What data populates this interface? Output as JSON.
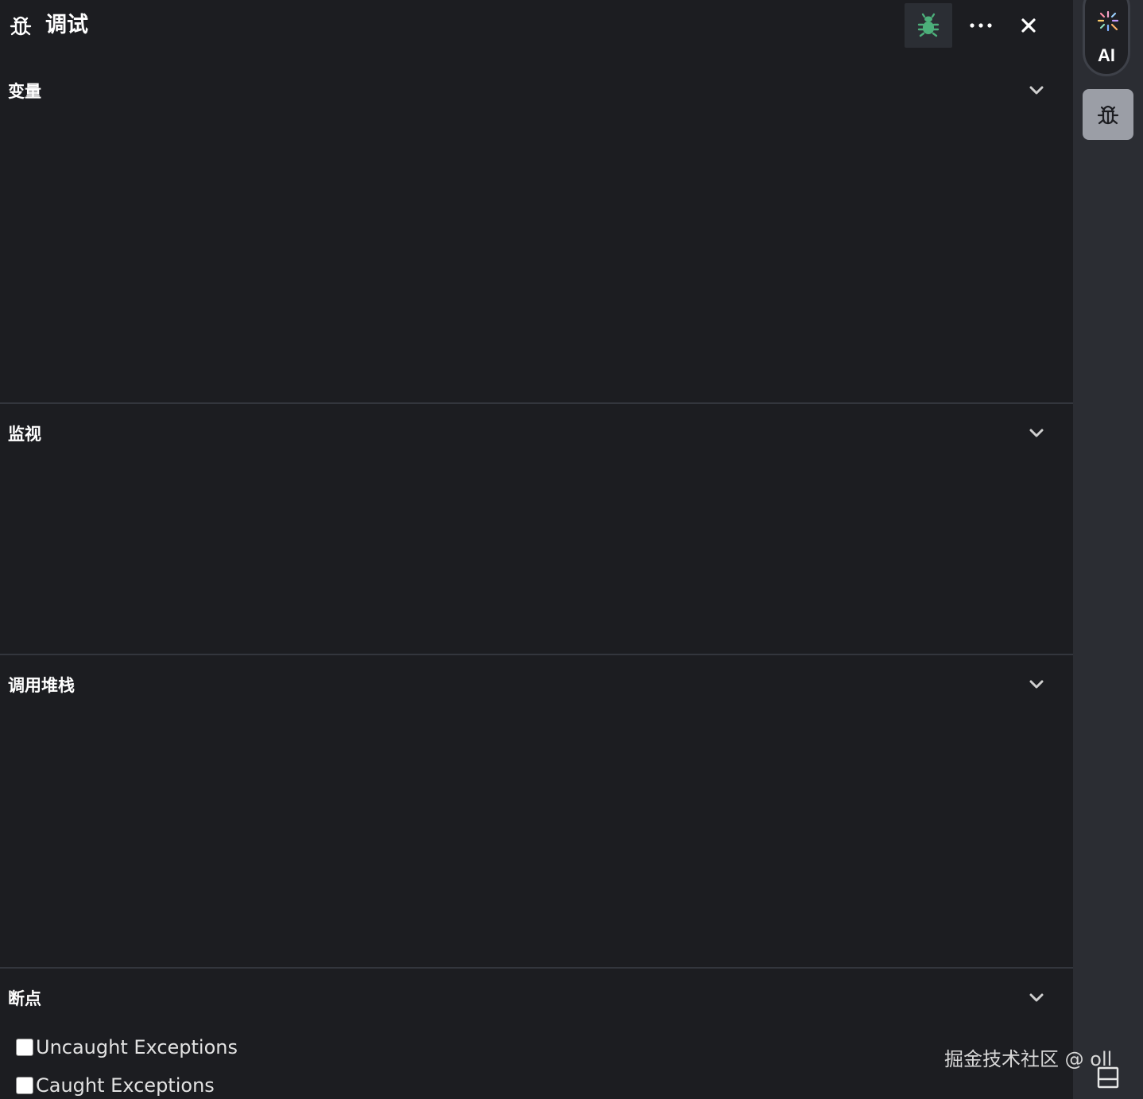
{
  "header": {
    "title": "调试",
    "icon": "bug-outline-icon",
    "bug_toggle_icon": "bug-filled-icon",
    "bug_toggle_color": "#4caf7a",
    "more_icon": "more-horizontal-icon",
    "close_icon": "close-icon"
  },
  "sections": [
    {
      "title": "变量",
      "icon": "chevron-down-icon"
    },
    {
      "title": "监视",
      "icon": "chevron-down-icon"
    },
    {
      "title": "调用堆栈",
      "icon": "chevron-down-icon"
    },
    {
      "title": "断点",
      "icon": "chevron-down-icon"
    }
  ],
  "breakpoints": {
    "exceptions": [
      {
        "label": "Uncaught Exceptions",
        "checked": false
      },
      {
        "label": "Caught Exceptions",
        "checked": false
      }
    ]
  },
  "sidebar": {
    "ai_label": "AI",
    "ai_icon": "magic-wand-sparkle-icon",
    "debug_icon": "bug-outline-icon",
    "panel_toggle_icon": "panel-bottom-icon"
  },
  "watermark": "掘金技术社区 @ oll",
  "colors": {
    "background": "#1c1d21",
    "sidebar": "#2b2d33",
    "divider": "#33363d",
    "active_sidebar_button": "#9b9ea6"
  }
}
